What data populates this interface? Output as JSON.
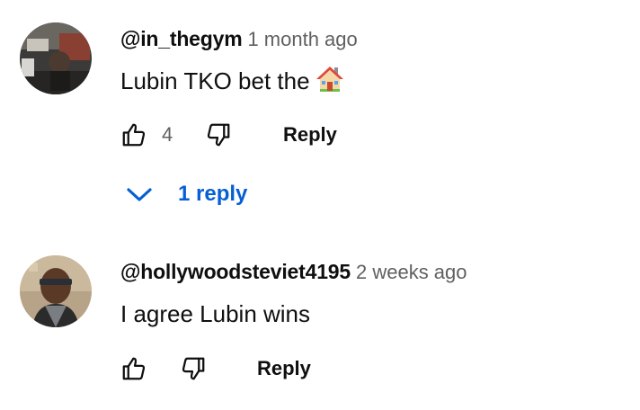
{
  "comments": [
    {
      "author": "@in_thegym",
      "time": "1 month ago",
      "text": "Lubin TKO bet the",
      "emoji": "house",
      "like_count": "4",
      "reply_label": "Reply",
      "replies_label": "1 reply"
    },
    {
      "author": "@hollywoodsteviet4195",
      "time": "2 weeks ago",
      "text": "I agree Lubin wins",
      "reply_label": "Reply"
    }
  ],
  "colors": {
    "link_blue": "#065fd4",
    "text_primary": "#0f0f0f",
    "text_secondary": "#606060"
  }
}
